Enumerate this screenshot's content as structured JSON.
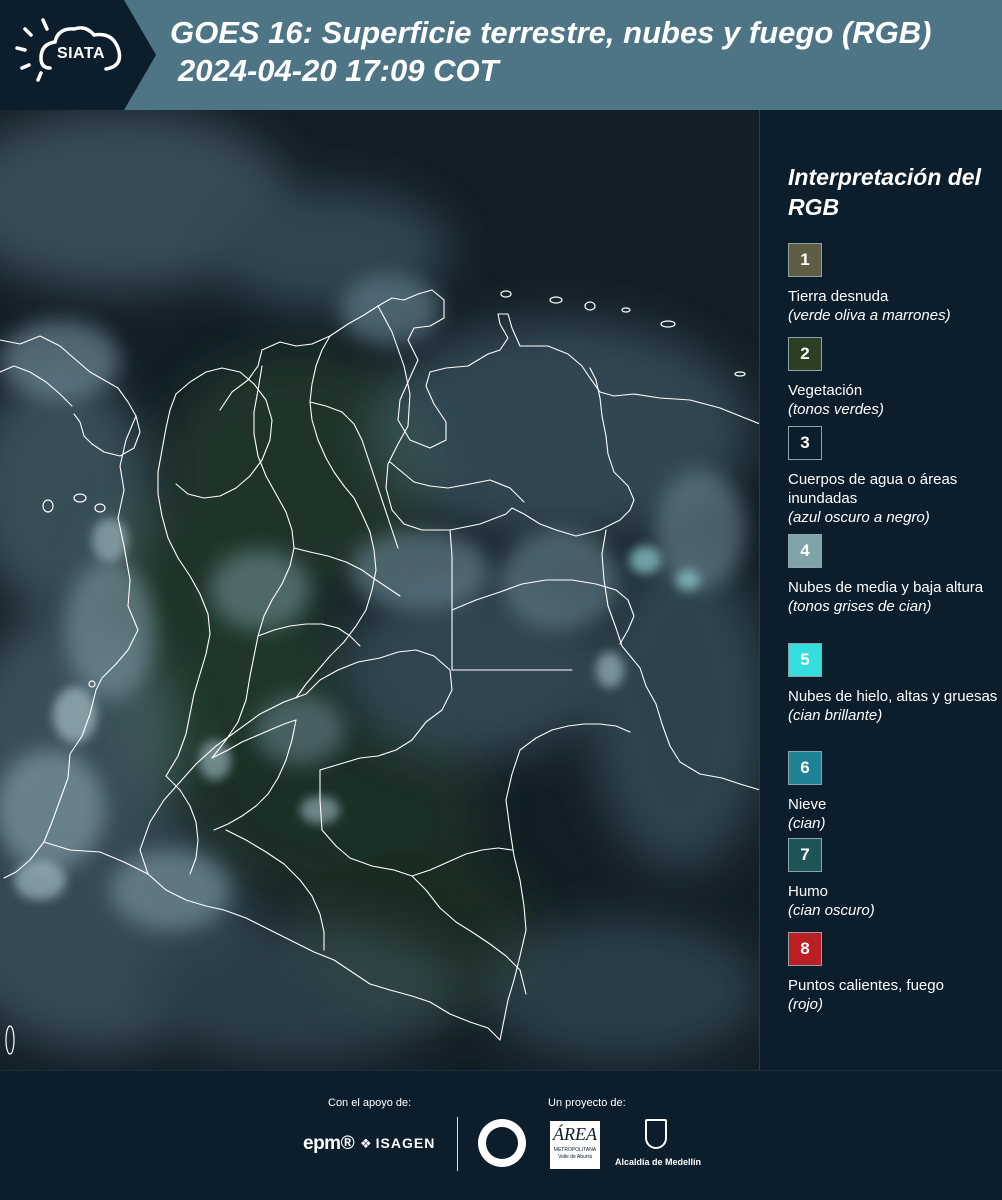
{
  "header": {
    "logo_text": "SIATA",
    "title": "GOES 16: Superficie terrestre, nubes y fuego (RGB)",
    "timestamp": "2024-04-20 17:09 COT",
    "colors": {
      "band": "#4d7585",
      "logo_panel": "#0c1e2b",
      "logo_mark": "#ffffff"
    }
  },
  "map": {
    "imagery": "GOES-16 RGB composite, mostly cloud-covered",
    "colors": {
      "land": "#1f3525",
      "ocean": "#0f1c24",
      "cloud": "#7e9aa6",
      "border": "#ffffff"
    }
  },
  "legend": {
    "title": "Interpretación del RGB",
    "items": [
      {
        "number": "1",
        "label": "Tierra desnuda",
        "note": "(verde oliva a marrones)",
        "color": "#5f5e45"
      },
      {
        "number": "2",
        "label": "Vegetación",
        "note": "(tonos verdes)",
        "color": "#2c3f25"
      },
      {
        "number": "3",
        "label": "Cuerpos de agua o áreas inundadas",
        "note": "(azul oscuro a negro)",
        "color": "#0c1e2b"
      },
      {
        "number": "4",
        "label": "Nubes de media y baja altura",
        "note": "(tonos grises de cian)",
        "color": "#7fa4a7"
      },
      {
        "number": "5",
        "label": "Nubes de hielo, altas y gruesas",
        "note": "(cian brillante)",
        "color": "#33dedc"
      },
      {
        "number": "6",
        "label": "Nieve",
        "note": "(cian)",
        "color": "#1f8295"
      },
      {
        "number": "7",
        "label": "Humo",
        "note": "(cian oscuro)",
        "color": "#1d5557"
      },
      {
        "number": "8",
        "label": "Puntos calientes, fuego",
        "note": "(rojo)",
        "color": "#bb1f24"
      }
    ]
  },
  "footer": {
    "support_caption": "Con el apoyo de:",
    "project_caption": "Un proyecto de:",
    "sponsor_logos": [
      "epm®",
      "ISAGEN"
    ],
    "partner_logos": [
      "ÁREA",
      "METROPOLITANA",
      "Valle de Aburrá"
    ],
    "alcaldia_text": "Alcaldía de Medellín"
  }
}
